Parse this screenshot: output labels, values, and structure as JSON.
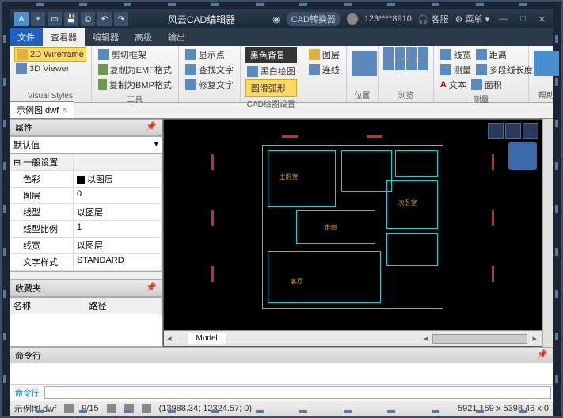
{
  "title": "风云CAD编辑器",
  "titleRight": {
    "converter": "CAD转换器",
    "user": "123****8910",
    "service": "客服",
    "menu": "菜单"
  },
  "menuTabs": {
    "file": "文件",
    "viewer": "查看器",
    "editor": "编辑器",
    "advanced": "高级",
    "output": "输出"
  },
  "ribbon": {
    "visualStyles": {
      "label": "Visual Styles",
      "wf2d": "2D Wireframe",
      "viewer3d": "3D Viewer"
    },
    "tools": {
      "label": "工具",
      "clip": "剪切框架",
      "emf": "复制为EMF格式",
      "bmp": "复制为BMP格式"
    },
    "g3": {
      "showpt": "显示点",
      "findtext": "查找文字",
      "edittext": "修复文字"
    },
    "cadset": {
      "label": "CAD绘图设置",
      "blackbg": "黑色背景",
      "bw": "黑白绘图",
      "smooth": "圆滑弧形"
    },
    "g5": {
      "layer": "图层",
      "lineseg": "连线"
    },
    "pos": {
      "label": "位置"
    },
    "browse": {
      "label": "浏览"
    },
    "measure": {
      "label": "测量",
      "linew": "线宽",
      "meas": "测量",
      "text": "文本",
      "dist": "距离",
      "polylen": "多段线长度",
      "area": "面积"
    },
    "help": {
      "label": "帮助"
    }
  },
  "fileTab": "示例图.dwf",
  "props": {
    "title": "属性",
    "default": "默认值",
    "general": "一般设置",
    "rows": [
      {
        "k": "色彩",
        "v": "以图层",
        "sw": true
      },
      {
        "k": "图层",
        "v": "0"
      },
      {
        "k": "线型",
        "v": "以图层"
      },
      {
        "k": "线型比例",
        "v": "1"
      },
      {
        "k": "线宽",
        "v": "以图层"
      },
      {
        "k": "文字样式",
        "v": "STANDARD"
      }
    ]
  },
  "fav": {
    "title": "收藏夹",
    "name": "名称",
    "path": "路径"
  },
  "modelTab": "Model",
  "cmd": {
    "title": "命令行",
    "prompt": "命令行:"
  },
  "status": {
    "file": "示例图.dwf",
    "page": "9/15",
    "coords": "(13988.34; 12324.57; 0)",
    "size": "5921.159 x 5398.46 x 0"
  }
}
